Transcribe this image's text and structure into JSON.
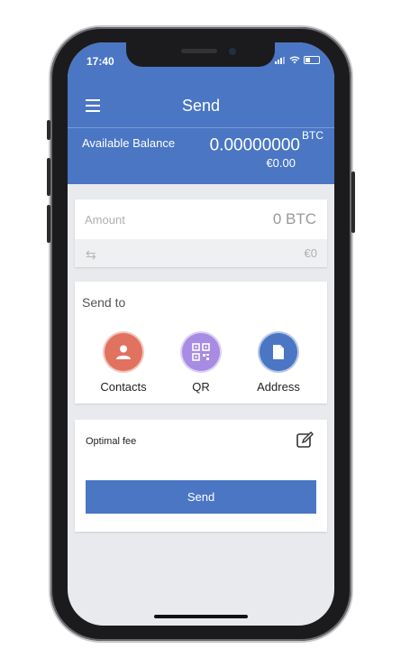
{
  "status": {
    "time": "17:40"
  },
  "header": {
    "title": "Send",
    "balance_label": "Available Balance",
    "balance_value": "0.00000000",
    "balance_unit": "BTC",
    "balance_fiat": "€0.00"
  },
  "amount": {
    "placeholder": "Amount",
    "value": "0 BTC",
    "fiat": "€0"
  },
  "send_to": {
    "label": "Send to",
    "options": [
      {
        "label": "Contacts",
        "color": "#e0725f",
        "icon": "contacts-icon"
      },
      {
        "label": "QR",
        "color": "#a88be3",
        "icon": "qr-icon"
      },
      {
        "label": "Address",
        "color": "#4a76c4",
        "icon": "document-icon"
      }
    ]
  },
  "fee": {
    "label": "Optimal fee",
    "edit_icon": "edit-icon"
  },
  "send_button": {
    "label": "Send"
  },
  "colors": {
    "accent": "#4a76c4",
    "background": "#e9eaee"
  }
}
